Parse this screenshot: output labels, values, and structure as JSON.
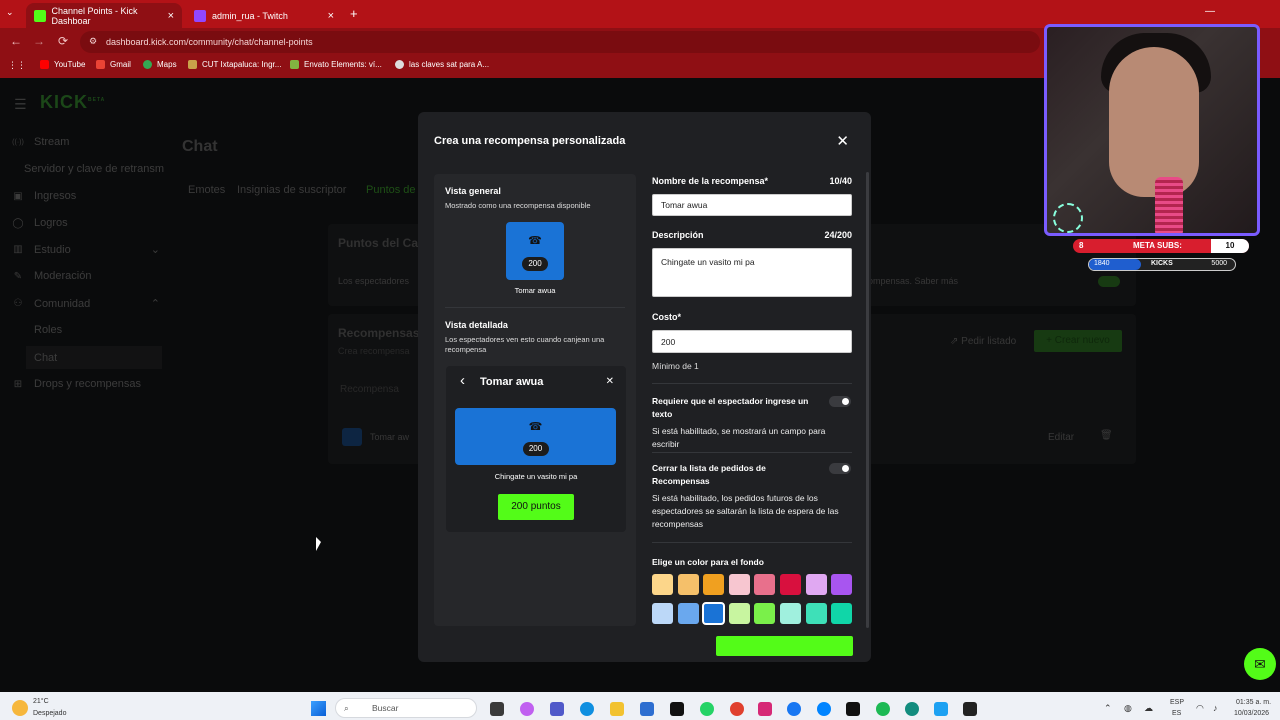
{
  "browser": {
    "tabs": [
      {
        "label": "Channel Points - Kick Dashboar",
        "close": "×"
      },
      {
        "label": "admin_rua - Twitch",
        "close": "×"
      }
    ],
    "new_tab": "+",
    "back": "←",
    "forward": "→",
    "reload": "⟳",
    "url": "dashboard.kick.com/community/chat/channel-points",
    "apps": "⋮⋮",
    "bookmarks": [
      "YouTube",
      "Gmail",
      "Maps",
      "CUT Ixtapaluca: Ingr...",
      "Envato Elements: ví...",
      "las claves sat para A..."
    ]
  },
  "app": {
    "logo": "KICK",
    "logo_sup": "BETA",
    "menu": "☰",
    "sidebar": [
      {
        "label": "Stream",
        "icon": "((·))"
      },
      {
        "label": "Servidor y clave de retransm",
        "icon": ""
      },
      {
        "label": "Ingresos",
        "icon": "▣"
      },
      {
        "label": "Logros",
        "icon": "◯"
      },
      {
        "label": "Estudio",
        "icon": "▥"
      },
      {
        "label": "Moderación",
        "icon": "✎"
      },
      {
        "label": "Comunidad",
        "icon": "⚇"
      },
      {
        "label": "Roles",
        "icon": ""
      },
      {
        "label": "Chat",
        "icon": ""
      },
      {
        "label": "Drops y recompensas",
        "icon": "⊞"
      }
    ],
    "page_title": "Chat",
    "subtabs": [
      "Emotes",
      "Insignias de suscriptor",
      "Puntos de"
    ],
    "bg_section1": "Puntos del Ca",
    "bg_section1_text": "Los espectadores",
    "bg_section1_right": "ompensas. Saber más",
    "bg_section2": "Recompensas",
    "bg_section2_sub": "Crea recompensa",
    "bg_pedir": "Pedir listado",
    "bg_crear": "Crear nuevo",
    "bg_table_head": "Recompensa",
    "bg_row_name": "Tomar aw",
    "bg_edit": "Editar"
  },
  "modal": {
    "title": "Crea una recompensa personalizada",
    "close": "✕",
    "overview": {
      "heading": "Vista general",
      "sub": "Mostrado como una recompensa disponible",
      "cost": "200",
      "name": "Tomar awua"
    },
    "detail": {
      "heading": "Vista detallada",
      "sub": "Los espectadores ven esto cuando canjean una recompensa",
      "back": "‹",
      "title": "Tomar awua",
      "close": "✕",
      "cost": "200",
      "description": "Chingate un vasito mi pa",
      "button": "200 puntos"
    },
    "form": {
      "name_label": "Nombre de la recompensa*",
      "name_count": "10/40",
      "name_value": "Tomar awua",
      "desc_label": "Descripción",
      "desc_count": "24/200",
      "desc_value": "Chingate un vasito mi pa",
      "cost_label": "Costo*",
      "cost_value": "200",
      "cost_hint": "Mínimo de 1",
      "req_text_label": "Requiere que el espectador ingrese un texto",
      "req_text_help": "Si está habilitado, se mostrará un campo para escribir",
      "close_queue_label": "Cerrar la lista de pedidos de Recompensas",
      "close_queue_help": "Si está habilitado, los pedidos futuros de los espectadores se saltarán la lista de espera de las recompensas",
      "color_label": "Elige un color para el fondo",
      "colors_row1": [
        "#fcd68a",
        "#f5c06a",
        "#f0a020",
        "#f7c6d0",
        "#e8708c",
        "#d8103e",
        "#e0a8f2",
        "#a855f0"
      ],
      "colors_row2": [
        "#bcd8f8",
        "#6aa8ee",
        "#1a73d6",
        "#c8f5a0",
        "#7af04a",
        "#a0f0de",
        "#3ee0b8",
        "#10d6a8"
      ],
      "selected_color": "#1a73d6"
    }
  },
  "overlay": {
    "meta_label": "META SUBS:",
    "meta_left": "8",
    "meta_right": "10",
    "kicks_left": "1840",
    "kicks_label": "KICKS",
    "kicks_right": "5000"
  },
  "taskbar": {
    "weather_temp": "21°C",
    "weather_desc": "Despejado",
    "search_placeholder": "Buscar",
    "lang": "ESP",
    "lang2": "ES",
    "time": "01:35 a. m.",
    "date": "10/03/2026"
  }
}
